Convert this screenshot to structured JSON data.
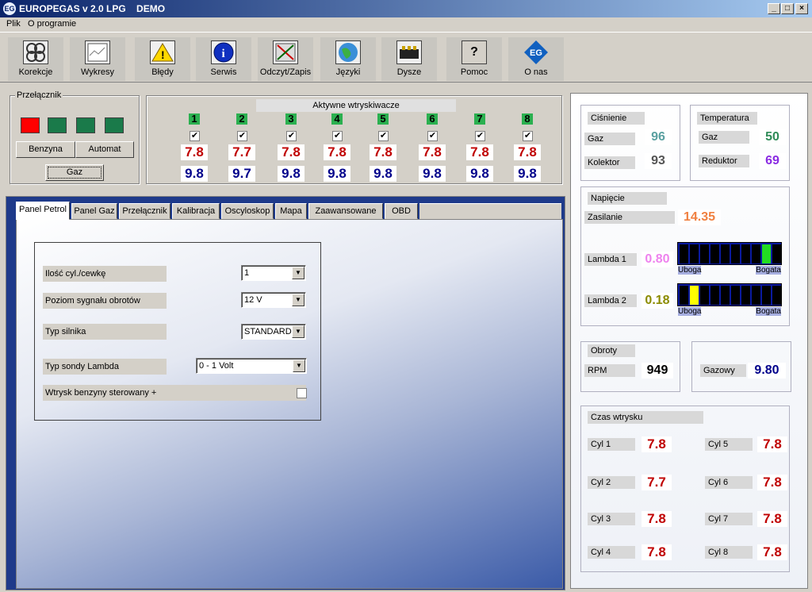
{
  "window": {
    "title": "EUROPEGAS v 2.0 LPG    DEMO",
    "app_icon": "EG",
    "minimize": "_",
    "maximize": "□",
    "close": "×"
  },
  "menu": [
    "Plik",
    "O programie"
  ],
  "toolbar": [
    {
      "label": "Korekcje",
      "icon": "fan-icon"
    },
    {
      "label": "Wykresy",
      "icon": "chart-icon"
    },
    {
      "label": "Błędy",
      "icon": "warning-icon"
    },
    {
      "label": "Serwis",
      "icon": "info-icon"
    },
    {
      "label": "Odczyt/Zapis",
      "icon": "read-write-icon"
    },
    {
      "label": "Języki",
      "icon": "globe-icon"
    },
    {
      "label": "Dysze",
      "icon": "nozzle-icon"
    },
    {
      "label": "Pomoc",
      "icon": "help-icon"
    },
    {
      "label": "O nas",
      "icon": "logo-icon"
    }
  ],
  "icons": {
    "warning": "!",
    "info": "i",
    "help": "?",
    "logo": "EG"
  },
  "switch": {
    "title": "Przełącznik",
    "leds": [
      "#ff0000",
      "#1a7a4a",
      "#1a7a4a",
      "#1a7a4a"
    ],
    "benzyna": "Benzyna",
    "automat": "Automat",
    "gaz": "Gaz"
  },
  "injectors": {
    "title": "Aktywne wtryskiwacze",
    "numbers": [
      "1",
      "2",
      "3",
      "4",
      "5",
      "6",
      "7",
      "8"
    ],
    "check": "✔",
    "top_values": [
      "7.8",
      "7.7",
      "7.8",
      "7.8",
      "7.8",
      "7.8",
      "7.8",
      "7.8"
    ],
    "bottom_values": [
      "9.8",
      "9.7",
      "9.8",
      "9.8",
      "9.8",
      "9.8",
      "9.8",
      "9.8"
    ]
  },
  "tabs": [
    "Panel Petrol",
    "Panel Gaz",
    "Przełącznik",
    "Kalibracja",
    "Oscyloskop",
    "Mapa",
    "Zaawansowane",
    "OBD"
  ],
  "form": {
    "cyl_label": "Ilość cyl./cewkę",
    "cyl_value": "1",
    "signal_label": "Poziom sygnału obrotów",
    "signal_value": "12 V",
    "engine_label": "Typ silnika",
    "engine_value": "STANDARD",
    "lambda_label": "Typ sondy Lambda",
    "lambda_value": "0 - 1 Volt",
    "inj_label": "Wtrysk benzyny sterowany +",
    "arrow": "▼"
  },
  "pressure": {
    "title": "Ciśnienie",
    "gaz_label": "Gaz",
    "gaz_value": "96",
    "kolektor_label": "Kolektor",
    "kolektor_value": "93"
  },
  "temperature": {
    "title": "Temperatura",
    "gaz_label": "Gaz",
    "gaz_value": "50",
    "reduktor_label": "Reduktor",
    "reduktor_value": "69"
  },
  "voltage": {
    "title": "Napięcie",
    "zasilanie_label": "Zasilanie",
    "zasilanie_value": "14.35",
    "lambda1_label": "Lambda 1",
    "lambda1_value": "0.80",
    "lambda1_active_segment": 8,
    "lambda2_label": "Lambda 2",
    "lambda2_value": "0.18",
    "lambda2_active_segment": 1,
    "uboga": "Uboga",
    "bogata": "Bogata"
  },
  "rpm": {
    "title": "Obroty",
    "label": "RPM",
    "value": "949"
  },
  "gazowy": {
    "label": "Gazowy",
    "value": "9.80"
  },
  "inj_time": {
    "title": "Czas wtrysku",
    "cylinders": [
      {
        "label": "Cyl 1",
        "value": "7.8"
      },
      {
        "label": "Cyl 2",
        "value": "7.7"
      },
      {
        "label": "Cyl 3",
        "value": "7.8"
      },
      {
        "label": "Cyl 4",
        "value": "7.8"
      },
      {
        "label": "Cyl 5",
        "value": "7.8"
      },
      {
        "label": "Cyl 6",
        "value": "7.8"
      },
      {
        "label": "Cyl 7",
        "value": "7.8"
      },
      {
        "label": "Cyl 8",
        "value": "7.8"
      }
    ]
  },
  "colors": {
    "accent_red": "#c00000",
    "accent_blue": "#00008b",
    "pressure_value": "#5aa0a0",
    "temp_gaz": "#2e8b57",
    "temp_reduktor": "#8a2be2",
    "voltage": "#f08040",
    "lambda1": "#ee82ee",
    "lambda2": "#8b8b00",
    "lambda1_segment": "#22dd22",
    "lambda2_segment": "#ffff00"
  }
}
